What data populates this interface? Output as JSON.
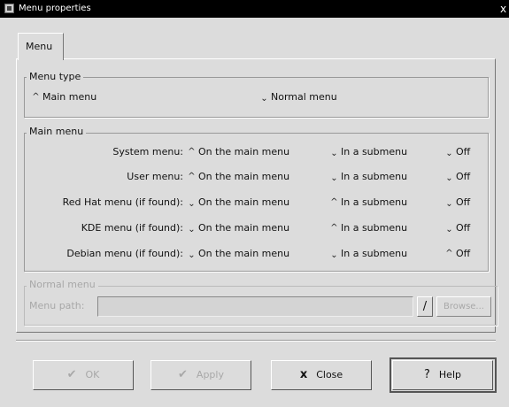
{
  "window": {
    "title": "Menu properties",
    "close_glyph": "x"
  },
  "tabs": [
    {
      "label": "Menu"
    }
  ],
  "menu_type": {
    "title": "Menu type",
    "options": [
      {
        "label": "Main menu",
        "selected": true
      },
      {
        "label": "Normal menu",
        "selected": false
      }
    ]
  },
  "main_menu": {
    "title": "Main menu",
    "col_labels": [
      "On the main menu",
      "In a submenu",
      "Off"
    ],
    "rows": [
      {
        "label": "System menu:",
        "choice": 0
      },
      {
        "label": "User menu:",
        "choice": 0
      },
      {
        "label": "Red Hat menu (if found):",
        "choice": 1
      },
      {
        "label": "KDE menu (if found):",
        "choice": 1
      },
      {
        "label": "Debian menu (if found):",
        "choice": 2
      }
    ]
  },
  "normal_menu": {
    "title": "Normal menu",
    "path_label": "Menu path:",
    "path_value": "",
    "browse_label": "Browse..."
  },
  "buttons": {
    "ok": "OK",
    "apply": "Apply",
    "close": "Close",
    "help": "Help"
  },
  "icons": {
    "ok": "ok-icon",
    "apply": "checkmark-icon",
    "close": "x-icon",
    "help": "question-icon"
  }
}
